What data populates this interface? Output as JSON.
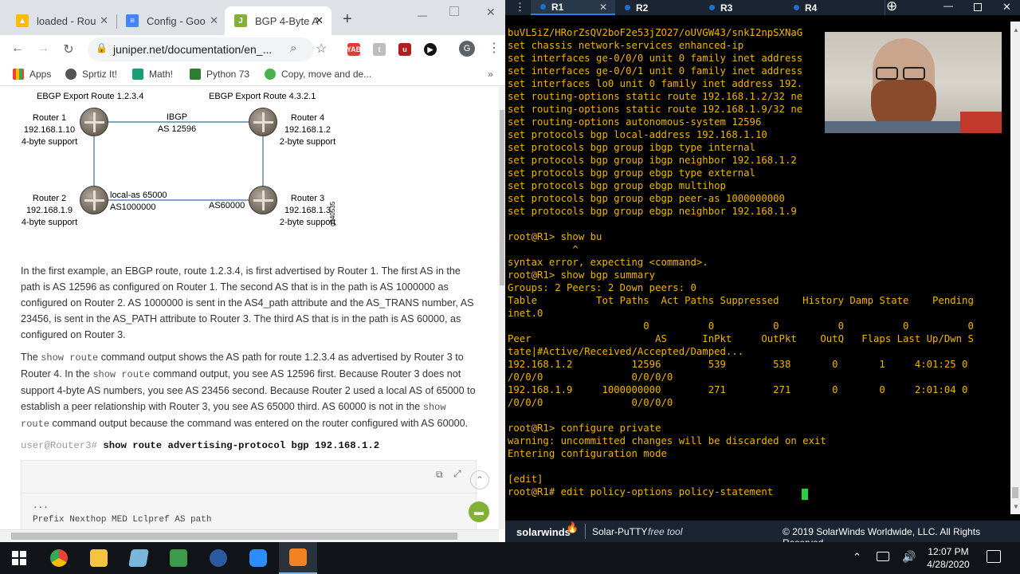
{
  "browser": {
    "tabs": [
      {
        "label": "loaded - Rou",
        "color": "#fbbc04"
      },
      {
        "label": "Config - Goo",
        "color": "#4285f4"
      },
      {
        "label": "BGP 4-Byte A",
        "color": "#84b135",
        "active": true
      }
    ],
    "url": "juniper.net/documentation/en_...",
    "avatar_letter": "G",
    "bookmarks": [
      "Apps",
      "Sprtiz It!",
      "Math!",
      "Python 73",
      "Copy, move and de..."
    ]
  },
  "diagram": {
    "ebgp_left": "EBGP Export Route 1.2.3.4",
    "ebgp_right": "EBGP Export Route 4.3.2.1",
    "r1": [
      "Router 1",
      "192.168.1.10",
      "4-byte support"
    ],
    "r2": [
      "Router 2",
      "192.168.1.9",
      "4-byte support"
    ],
    "r3": [
      "Router 3",
      "192.168.1.3",
      "2-byte support"
    ],
    "r4": [
      "Router 4",
      "192.168.1.2",
      "2-byte support"
    ],
    "ibgp": [
      "IBGP",
      "AS 12596"
    ],
    "local_as": [
      "local-as 65000",
      "AS1000000"
    ],
    "as60000": "AS60000",
    "fig_id": "g040535"
  },
  "article": {
    "p1": "In the first example, an EBGP route, route 1.2.3.4, is first advertised by Router 1. The first AS in the path is AS 12596 as configured on Router 1. The second AS that is in the path is AS 1000000 as configured on Router 2. AS 1000000 is sent in the AS4_path attribute and the AS_TRANS number, AS 23456, is sent in the AS_PATH attribute to Router 3. The third AS that is in the path is AS 60000, as configured on Router 3.",
    "p2a": "The ",
    "p2code1": "show route",
    "p2b": " command output shows the AS path for route 1.2.3.4 as advertised by Router 3 to Router 4. In the ",
    "p2code2": "show route",
    "p2c": " command output, you see AS 12596 first. Because Router 3 does not support 4-byte AS numbers, you see AS 23456 second. Because Router 2 used a local AS of 65000 to establish a peer relationship with Router 3, you see AS 65000 third. AS 60000 is not in the ",
    "p2code3": "show route",
    "p2d": " command output because the command was entered on the router configured with AS 60000.",
    "prompt": "user@Router3# ",
    "command": "show route advertising-protocol bgp 192.168.1.2",
    "code_lines": [
      "...",
      "Prefix Nexthop MED Lclpref AS path"
    ]
  },
  "putty": {
    "tabs": [
      "R1",
      "R2",
      "R3",
      "R4"
    ],
    "terminal_lines": [
      "buVL5iZ/HRorZsQV2boF2e53jZO27/oUVGW43/snkI2npSXNaG",
      "set chassis network-services enhanced-ip",
      "set interfaces ge-0/0/0 unit 0 family inet address",
      "set interfaces ge-0/0/1 unit 0 family inet address",
      "set interfaces lo0 unit 0 family inet address 192.",
      "set routing-options static route 192.168.1.2/32 ne",
      "set routing-options static route 192.168.1.9/32 ne",
      "set routing-options autonomous-system 12596",
      "set protocols bgp local-address 192.168.1.10",
      "set protocols bgp group ibgp type internal",
      "set protocols bgp group ibgp neighbor 192.168.1.2",
      "set protocols bgp group ebgp type external",
      "set protocols bgp group ebgp multihop",
      "set protocols bgp group ebgp peer-as 1000000000",
      "set protocols bgp group ebgp neighbor 192.168.1.9",
      "",
      "root@R1> show bu",
      "           ^",
      "syntax error, expecting <command>.",
      "root@R1> show bgp summary",
      "Groups: 2 Peers: 2 Down peers: 0",
      "Table          Tot Paths  Act Paths Suppressed    History Damp State    Pending",
      "inet.0",
      "                       0          0          0          0          0          0",
      "Peer                     AS      InPkt     OutPkt    OutQ   Flaps Last Up/Dwn S",
      "tate|#Active/Received/Accepted/Damped...",
      "192.168.1.2          12596        539        538       0       1     4:01:25 0",
      "/0/0/0               0/0/0/0",
      "192.168.1.9     1000000000        271        271       0       0     2:01:04 0",
      "/0/0/0               0/0/0/0",
      "",
      "root@R1> configure private",
      "warning: uncommitted changes will be discarded on exit",
      "Entering configuration mode",
      "",
      "[edit]",
      "root@R1# edit policy-options policy-statement "
    ],
    "footer_brand": "solarwinds",
    "footer_app": "Solar-PuTTY",
    "footer_free": "free tool",
    "footer_copyright": "© 2019 SolarWinds Worldwide, LLC. All Rights Reserved."
  },
  "taskbar": {
    "time": "12:07 PM",
    "date": "4/28/2020"
  }
}
